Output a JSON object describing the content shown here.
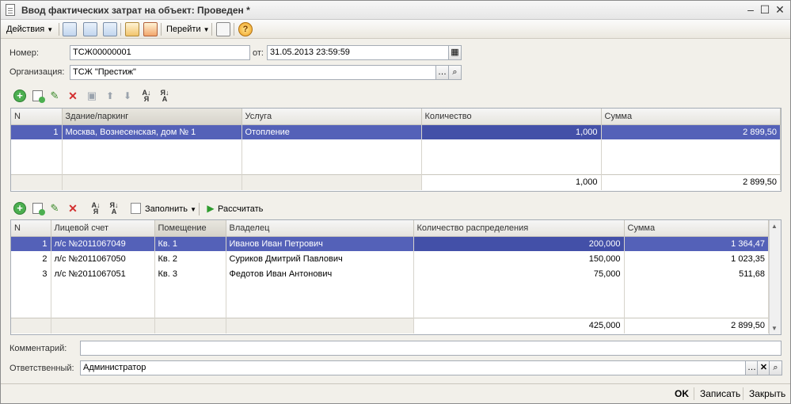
{
  "window": {
    "title": "Ввод фактических затрат на объект: Проведен *"
  },
  "toolbar": {
    "actions_label": "Действия",
    "goto_label": "Перейти"
  },
  "form": {
    "number_label": "Номер:",
    "number_value": "ТСЖ00000001",
    "date_label": "от:",
    "date_value": "31.05.2013 23:59:59",
    "org_label": "Организация:",
    "org_value": "ТСЖ \"Престиж\"",
    "comment_label": "Комментарий:",
    "comment_value": "",
    "responsible_label": "Ответственный:",
    "responsible_value": "Администратор"
  },
  "table1": {
    "columns": [
      "N",
      "Здание/паркинг",
      "Услуга",
      "Количество",
      "Сумма"
    ],
    "rows": [
      {
        "n": "1",
        "building": "Москва, Вознесенская, дом № 1",
        "service": "Отопление",
        "qty": "1,000",
        "sum": "2 899,50"
      }
    ],
    "footer": {
      "qty": "1,000",
      "sum": "2 899,50"
    }
  },
  "table2_toolbar": {
    "fill_label": "Заполнить",
    "calc_label": "Рассчитать"
  },
  "table2": {
    "columns": [
      "N",
      "Лицевой счет",
      "Помещение",
      "Владелец",
      "Количество распределения",
      "Сумма"
    ],
    "rows": [
      {
        "n": "1",
        "account": "л/с №2011067049",
        "room": "Кв. 1",
        "owner": "Иванов Иван Петрович",
        "qty": "200,000",
        "sum": "1 364,47"
      },
      {
        "n": "2",
        "account": "л/с №2011067050",
        "room": "Кв. 2",
        "owner": "Суриков Дмитрий Павлович",
        "qty": "150,000",
        "sum": "1 023,35"
      },
      {
        "n": "3",
        "account": "л/с №2011067051",
        "room": "Кв. 3",
        "owner": "Федотов Иван Антонович",
        "qty": "75,000",
        "sum": "511,68"
      }
    ],
    "footer": {
      "qty": "425,000",
      "sum": "2 899,50"
    }
  },
  "bottom": {
    "ok_label": "OK",
    "save_label": "Записать",
    "close_label": "Закрыть"
  },
  "colors": {
    "selection": "#5461b8",
    "window_bg": "#f2f0ea"
  }
}
